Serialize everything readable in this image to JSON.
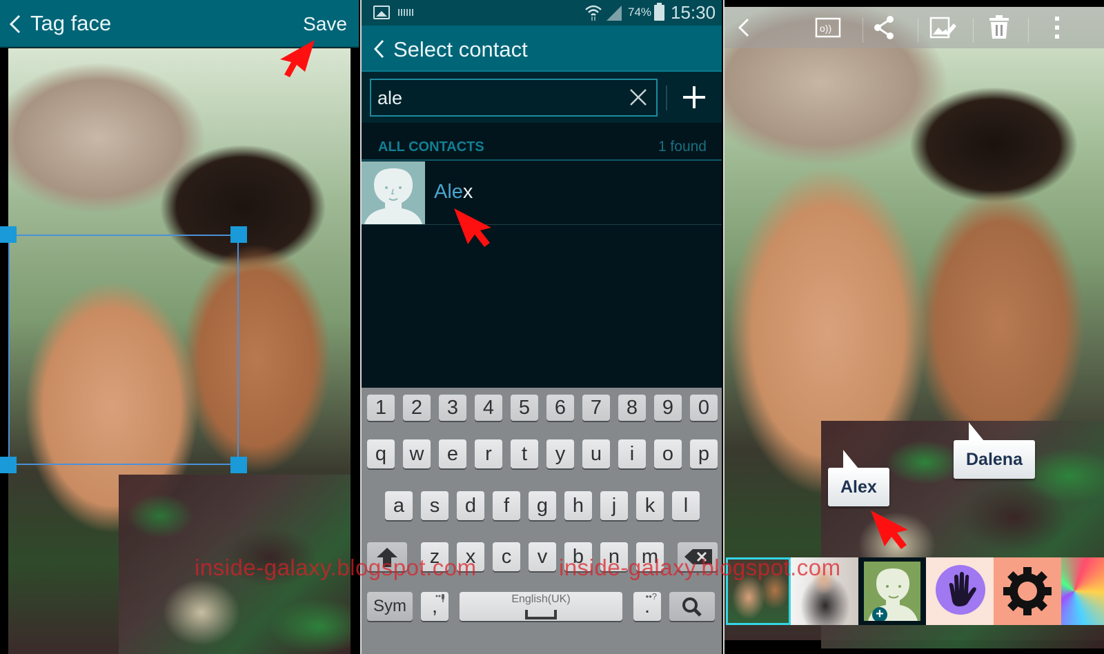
{
  "panel_tag_face": {
    "title": "Tag face",
    "save_label": "Save",
    "icons": {
      "back": "chevron-left-icon"
    }
  },
  "panel_select_contact": {
    "status_bar": {
      "battery_percent": "74%",
      "time": "15:30",
      "icons": [
        "gallery-notification-icon",
        "keyboard-notification-icon",
        "wifi-icon",
        "signal-icon",
        "battery-icon"
      ]
    },
    "title": "Select contact",
    "search": {
      "value": "ale",
      "placeholder": ""
    },
    "section_label": "ALL CONTACTS",
    "result_count": "1 found",
    "contacts": [
      {
        "name_match": "Ale",
        "name_rest": "x"
      }
    ],
    "keyboard": {
      "number_row": [
        "1",
        "2",
        "3",
        "4",
        "5",
        "6",
        "7",
        "8",
        "9",
        "0"
      ],
      "row1": [
        "q",
        "w",
        "e",
        "r",
        "t",
        "y",
        "u",
        "i",
        "o",
        "p"
      ],
      "row2": [
        "a",
        "s",
        "d",
        "f",
        "g",
        "h",
        "j",
        "k",
        "l"
      ],
      "row3": [
        "z",
        "x",
        "c",
        "v",
        "b",
        "n",
        "m"
      ],
      "sym_label": "Sym",
      "comma_label": ",",
      "space_label": "English(UK)",
      "period_label": ".",
      "period_sub": "••?"
    }
  },
  "panel_gallery": {
    "toolbar_icons": [
      "back-icon",
      "cast-icon",
      "share-icon",
      "edit-icon",
      "delete-icon",
      "more-icon"
    ],
    "tags": [
      {
        "label": "Alex"
      },
      {
        "label": "Dalena"
      }
    ],
    "tray_items": [
      "current-photo",
      "contact-photo",
      "add-contact",
      "hand-gesture-app",
      "settings-app",
      "wallpaper"
    ]
  },
  "watermark": "inside-galaxy.blogspot.com",
  "colors": {
    "app_bar": "#006577",
    "status_bar": "#024a56",
    "contact_highlight": "#4aa6d0",
    "section_label": "#127f94",
    "face_box": "#1a9ad8",
    "tag_text": "#1e3352",
    "annotation_arrow": "#ff1010"
  }
}
